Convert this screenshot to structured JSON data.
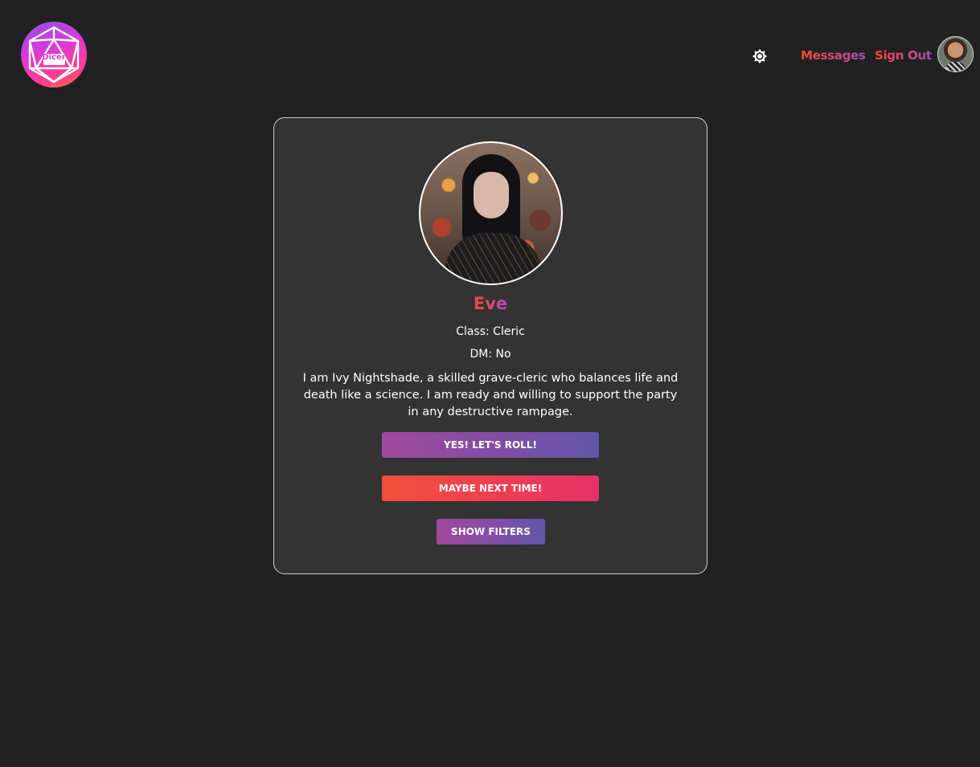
{
  "header": {
    "logo_text": "Dicer",
    "nav": {
      "messages_label": "Messages",
      "signout_label": "Sign Out"
    },
    "icons": {
      "theme_toggle": "brightness-icon",
      "user_avatar": "avatar"
    }
  },
  "profile": {
    "name": "Eve",
    "class_line": "Class: Cleric",
    "dm_line": "DM: No",
    "bio": "I am Ivy Nightshade, a skilled grave-cleric who balances life and death like a science. I am ready and willing to support the party in any destructive rampage."
  },
  "actions": {
    "yes_label": "YES! LET'S ROLL!",
    "maybe_label": "MAYBE NEXT TIME!",
    "filters_label": "SHOW FILTERS"
  },
  "colors": {
    "background": "#212121",
    "card": "#333333",
    "accent_orange": "#f04a3a",
    "accent_purple": "#7e4fa6",
    "accent_pink": "#ee3d55"
  }
}
